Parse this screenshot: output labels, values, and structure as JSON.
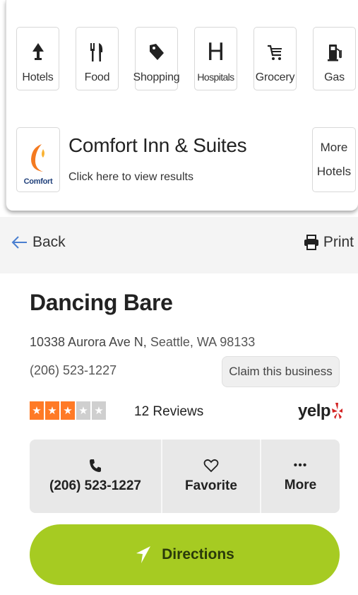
{
  "categories": [
    {
      "label": "Hotels",
      "icon": "hotel-icon"
    },
    {
      "label": "Food",
      "icon": "fork-knife-icon"
    },
    {
      "label": "Shopping",
      "icon": "tag-icon"
    },
    {
      "label": "Hospitals",
      "icon": "hospital-icon"
    },
    {
      "label": "Grocery",
      "icon": "cart-icon"
    },
    {
      "label": "Gas",
      "icon": "gas-pump-icon"
    }
  ],
  "promo": {
    "brand": "Comfort",
    "title": "Comfort Inn & Suites",
    "subtitle": "Click here to view results",
    "more_line1": "More",
    "more_line2": "Hotels"
  },
  "nav": {
    "back_label": "Back",
    "print_label": "Print"
  },
  "business": {
    "name": "Dancing Bare",
    "address_street": "10338 Aurora Ave N,",
    "address_city": "Seattle, WA 98133",
    "phone": "(206) 523-1227",
    "claim_label": "Claim this business",
    "rating": 3,
    "rating_max": 5,
    "reviews_label": "12 Reviews",
    "source": "yelp"
  },
  "actions": {
    "call_label": "(206) 523-1227",
    "favorite_label": "Favorite",
    "more_label": "More",
    "more_glyph": "•••",
    "directions_label": "Directions"
  },
  "colors": {
    "accent_green": "#a6cb22",
    "star_orange": "#ff7a26",
    "yelp_red": "#d32323"
  }
}
